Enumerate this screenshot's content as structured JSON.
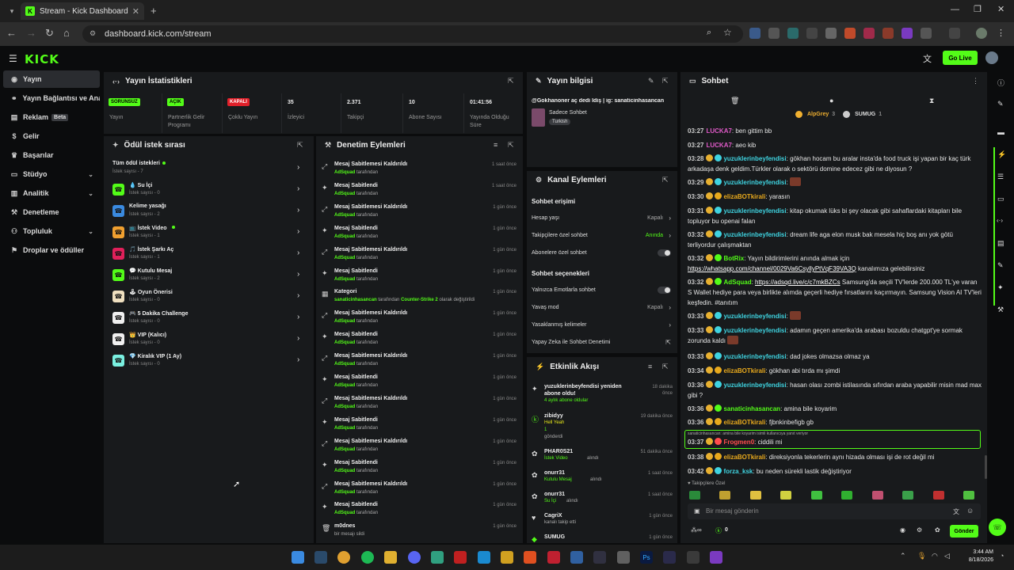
{
  "browser": {
    "tab_title": "Stream - Kick Dashboard",
    "url": "dashboard.kick.com/stream"
  },
  "brand": {
    "logo": "KICK",
    "accent": "#53fc18"
  },
  "header": {
    "go_live": "Go Live"
  },
  "sidebar": {
    "items": [
      {
        "label": "Yayın",
        "icon": "broadcast-icon"
      },
      {
        "label": "Yayın Bağlantısı ve Anahtarı",
        "icon": "link-icon"
      },
      {
        "label": "Reklam",
        "icon": "megaphone-icon",
        "badge": "Beta"
      },
      {
        "label": "Gelir",
        "icon": "dollar-icon"
      },
      {
        "label": "Başarılar",
        "icon": "trophy-icon"
      },
      {
        "label": "Stüdyo",
        "icon": "studio-icon"
      },
      {
        "label": "Analitik",
        "icon": "chart-icon"
      },
      {
        "label": "Denetleme",
        "icon": "gavel-icon"
      },
      {
        "label": "Topluluk",
        "icon": "community-icon"
      },
      {
        "label": "Droplar ve ödüller",
        "icon": "gift-icon"
      }
    ]
  },
  "stats": {
    "title": "Yayın İstatistikleri",
    "cols": [
      {
        "value": "SORUNSUZ",
        "label": "Yayın"
      },
      {
        "value": "AÇIK",
        "label": "Partnerlik Gelir Programı"
      },
      {
        "value": "KAPALI",
        "label": "Çoklu Yayın"
      },
      {
        "value": "35",
        "label": "İzleyici"
      },
      {
        "value": "2.371",
        "label": "Takipçi"
      },
      {
        "value": "10",
        "label": "Abone Sayısı"
      },
      {
        "value": "01:41:56",
        "label": "Yayında Olduğu Süre"
      }
    ]
  },
  "stream_info": {
    "title": "Yayın bilgisi",
    "stream_title": "@Gokhanoner aç dedi İdiş | ig: sanaticinhasancan",
    "category": "Sadece Sohbet",
    "language": "Turkish"
  },
  "rewards": {
    "title": "Ödül istek sırası",
    "items": [
      {
        "name": "Tüm ödül istekleri",
        "sub": "İstek sayısı - 7"
      },
      {
        "name": "💧 Su İçi",
        "sub": "İstek sayısı - 0"
      },
      {
        "name": "Kelime yasağı",
        "sub": "İstek sayısı - 2"
      },
      {
        "name": "📺 İstek Video",
        "sub": "İstek sayısı - 1"
      },
      {
        "name": "🎵 İstek Şarkı Aç",
        "sub": "İstek sayısı - 1"
      },
      {
        "name": "💬 Kutulu Mesaj",
        "sub": "İstek sayısı - 2"
      },
      {
        "name": "🕹 Oyun Önerisi",
        "sub": "İstek sayısı - 0"
      },
      {
        "name": "🎮 5 Dakika Challenge",
        "sub": "İstek sayısı - 0"
      },
      {
        "name": "👑 VIP (Kalıcı)",
        "sub": "İstek sayısı - 0"
      },
      {
        "name": "💎 Kiralık VIP (1 Ay)",
        "sub": "İstek sayısı - 0"
      }
    ]
  },
  "moderation": {
    "title": "Denetim Eylemleri",
    "suffix": "tarafından",
    "rows": [
      {
        "title": "Mesaj Sabitlemesi Kaldırıldı",
        "actor": "AdSquad",
        "time": "1 saat önce"
      },
      {
        "title": "Mesaj Sabitlendi",
        "actor": "AdSquad",
        "time": "1 saat önce"
      },
      {
        "title": "Mesaj Sabitlemesi Kaldırıldı",
        "actor": "AdSquad",
        "time": "1 gün önce"
      },
      {
        "title": "Mesaj Sabitlendi",
        "actor": "AdSquad",
        "time": "1 gün önce"
      },
      {
        "title": "Mesaj Sabitlemesi Kaldırıldı",
        "actor": "AdSquad",
        "time": "1 gün önce"
      },
      {
        "title": "Mesaj Sabitlendi",
        "actor": "AdSquad",
        "time": "1 gün önce"
      },
      {
        "title": "Kategori",
        "actor": "sanaticinhasancan",
        "time": "1 gün önce",
        "extra": "Counter-Strike 2",
        "extra_suffix": "olarak değiştirildi"
      },
      {
        "title": "Mesaj Sabitlemesi Kaldırıldı",
        "actor": "AdSquad",
        "time": "1 gün önce"
      },
      {
        "title": "Mesaj Sabitlendi",
        "actor": "AdSquad",
        "time": "1 gün önce"
      },
      {
        "title": "Mesaj Sabitlemesi Kaldırıldı",
        "actor": "AdSquad",
        "time": "1 gün önce"
      },
      {
        "title": "Mesaj Sabitlendi",
        "actor": "AdSquad",
        "time": "1 gün önce"
      },
      {
        "title": "Mesaj Sabitlemesi Kaldırıldı",
        "actor": "AdSquad",
        "time": "1 gün önce"
      },
      {
        "title": "Mesaj Sabitlendi",
        "actor": "AdSquad",
        "time": "1 gün önce"
      },
      {
        "title": "Mesaj Sabitlemesi Kaldırıldı",
        "actor": "AdSquad",
        "time": "1 gün önce"
      },
      {
        "title": "Mesaj Sabitlendi",
        "actor": "AdSquad",
        "time": "1 gün önce"
      },
      {
        "title": "Mesaj Sabitlemesi Kaldırıldı",
        "actor": "AdSquad",
        "time": "1 gün önce"
      },
      {
        "title": "Mesaj Sabitlendi",
        "actor": "AdSquad",
        "time": "1 gün önce"
      },
      {
        "title": "m0dnes",
        "sub": "bir mesajı sildi",
        "time": "1 gün önce"
      }
    ]
  },
  "channel_actions": {
    "title": "Kanal Eylemleri",
    "chat_access": "Sohbet erişimi",
    "account_age": "Hesap yaşı",
    "account_age_val": "Kapalı",
    "followers_only": "Takipçilere özel sohbet",
    "followers_only_val": "Anında",
    "subs_only": "Abonelere özel sohbet",
    "chat_options": "Sohbet seçenekleri",
    "emotes_only": "Yalnızca Emotlarla sohbet",
    "slow_mode": "Yavaş mod",
    "slow_mode_val": "Kapalı",
    "banned_words": "Yasaklanmış kelimeler",
    "ai_mod": "Yapay Zeka ile Sohbet Denetimi"
  },
  "activity": {
    "title": "Etkinlik Akışı",
    "items": [
      {
        "title": "yuzuklerinbeyfendisi yeniden abone oldu!",
        "sub": "4 aylık abone oldular",
        "time": "18 dakika önce"
      },
      {
        "title": "zibidyy",
        "sub": "Hell Yeah",
        "sub2": "1",
        "sub3": "gönderdi",
        "time": "19 dakika önce"
      },
      {
        "title": "PHAR0S21",
        "sub": "İstek Video",
        "sub_suffix": "alındı",
        "time": "51 dakika önce"
      },
      {
        "title": "onurr31",
        "sub": "Kutulu Mesaj",
        "sub_suffix": "alındı",
        "time": "1 saat önce"
      },
      {
        "title": "onurr31",
        "sub": "Su İçi",
        "sub_suffix": "alındı",
        "time": "1 saat önce"
      },
      {
        "title": "CagriX",
        "sub": "kanalı takip etti",
        "time": "1 gün önce"
      },
      {
        "title": "SUMUG",
        "time": "1 gün önce"
      }
    ]
  },
  "chat": {
    "title": "Sohbet",
    "top_users": [
      {
        "name": "AlpGrey",
        "count": "3"
      },
      {
        "name": "SUMUG",
        "count": "1"
      }
    ],
    "messages": [
      {
        "time": "03:27",
        "user": "LUCKA7",
        "color": "#e05ac8",
        "text": "ben gittim bb"
      },
      {
        "time": "03:27",
        "user": "LUCKA7",
        "color": "#e05ac8",
        "text": "aeo kib"
      },
      {
        "time": "03:28",
        "user": "yuzuklerinbeyfendisi",
        "color": "#3fd3e0",
        "text": "gökhan hocam bu aralar insta'da food truck işi yapan bir kaç türk arkadaşa denk geldim.Türkler olarak o sektörü domine edecez gibi ne diyosun ?"
      },
      {
        "time": "03:29",
        "user": "yuzuklerinbeyfendisi",
        "color": "#3fd3e0",
        "text": ""
      },
      {
        "time": "03:30",
        "user": "elizaBOTkirali",
        "color": "#e8a91c",
        "text": "yarasın"
      },
      {
        "time": "03:31",
        "user": "yuzuklerinbeyfendisi",
        "color": "#3fd3e0",
        "text": "kitap okumak lüks bi şey olacak gibi sahaflardaki kitapları bile topluyor bu openai falan"
      },
      {
        "time": "03:32",
        "user": "yuzuklerinbeyfendisi",
        "color": "#3fd3e0",
        "text": "dream life aga elon musk bak mesela hiç boş anı yok götü terliyordur çalışmaktan"
      },
      {
        "time": "03:32",
        "user": "BotRix",
        "color": "#53fc18",
        "text": "Yayın bildirimlerini anında almak için",
        "link": "https://whatsapp.com/channel/0029Va6CsyllyPtVqF39VA3Q",
        "text2": "kanalımıza gelebilirsiniz"
      },
      {
        "time": "03:32",
        "user": "AdSquad",
        "color": "#53fc18",
        "link": "https://adsqd.live/c/c7mkBZCs",
        "text": "Samsung'da seçili TV'lerde 200.000 TL'ye varan S Wallet hediye para veya birlikte alımda geçerli hediye fırsatlarını kaçırmayın. Samsung Vision AI TV'leri keşfedin. #tanıtım"
      },
      {
        "time": "03:33",
        "user": "yuzuklerinbeyfendisi",
        "color": "#3fd3e0",
        "text": ""
      },
      {
        "time": "03:33",
        "user": "yuzuklerinbeyfendisi",
        "color": "#3fd3e0",
        "text": "adamın geçen amerika'da arabası bozuldu chatgpt'ye sormak zorunda kaldı"
      },
      {
        "time": "03:33",
        "user": "yuzuklerinbeyfendisi",
        "color": "#3fd3e0",
        "text": "dad jokes olmazsa olmaz ya"
      },
      {
        "time": "03:34",
        "user": "elizaBOTkirali",
        "color": "#e8a91c",
        "text": "gökhan abi tırda mı şimdi"
      },
      {
        "time": "03:36",
        "user": "yuzuklerinbeyfendisi",
        "color": "#3fd3e0",
        "text": "hasan olası zombi istilasında sıfırdan araba yapabilir misin mad max gibi ?"
      },
      {
        "time": "03:36",
        "user": "sanaticinhasancan",
        "color": "#53fc18",
        "text": "amina bile koyarim"
      },
      {
        "time": "03:36",
        "user": "elizaBOTkirali",
        "color": "#e8a91c",
        "text": "fjbnkinbefigb gb"
      },
      {
        "time": "03:37",
        "user": "Frogmen0",
        "color": "#ff4d4d",
        "text": "ciddili mi",
        "reply": "sanaticinhasancan: amina bile koyarim isimli kullanıcıya yanıt veriyor"
      },
      {
        "time": "03:38",
        "user": "elizaBOTkirali",
        "color": "#e8a91c",
        "text": "direksiyonla tekerlerin aynı hizada olması işi de rot değil mi"
      },
      {
        "time": "03:42",
        "user": "forza_ksk",
        "color": "#3fd3e0",
        "text": "bu neden sürekli lastik değiştiriyor"
      }
    ],
    "followers_only_note": "Takipçilere Özel",
    "input_placeholder": "Bir mesaj gönderin",
    "send": "Gönder",
    "points": "0"
  },
  "taskbar": {
    "time": "3:44 AM",
    "date": "8/18/2026"
  }
}
